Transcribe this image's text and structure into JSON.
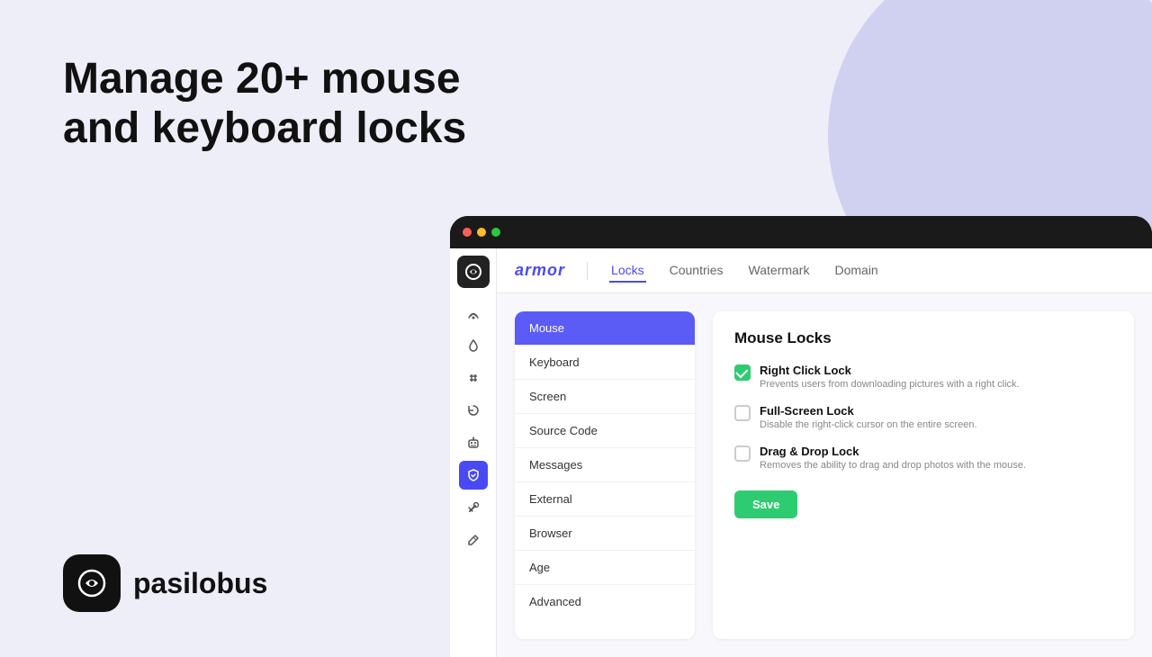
{
  "page": {
    "background_color": "#eeeef8"
  },
  "hero": {
    "line1": "Manage 20+ mouse",
    "line2": "and keyboard locks"
  },
  "brand": {
    "name": "pasilobus"
  },
  "app": {
    "nav": {
      "brand_name": "armor",
      "tabs": [
        {
          "id": "locks",
          "label": "Locks",
          "active": true
        },
        {
          "id": "countries",
          "label": "Countries",
          "active": false
        },
        {
          "id": "watermark",
          "label": "Watermark",
          "active": false
        },
        {
          "id": "domain",
          "label": "Domain",
          "active": false
        }
      ]
    },
    "categories": [
      {
        "id": "mouse",
        "label": "Mouse",
        "active": true
      },
      {
        "id": "keyboard",
        "label": "Keyboard",
        "active": false
      },
      {
        "id": "screen",
        "label": "Screen",
        "active": false
      },
      {
        "id": "source-code",
        "label": "Source Code",
        "active": false
      },
      {
        "id": "messages",
        "label": "Messages",
        "active": false
      },
      {
        "id": "external",
        "label": "External",
        "active": false
      },
      {
        "id": "browser",
        "label": "Browser",
        "active": false
      },
      {
        "id": "age",
        "label": "Age",
        "active": false
      },
      {
        "id": "advanced",
        "label": "Advanced",
        "active": false
      }
    ],
    "locks_panel": {
      "title": "Mouse Locks",
      "options": [
        {
          "id": "right-click",
          "name": "Right Click Lock",
          "description": "Prevents users from downloading pictures with a right click.",
          "checked": true
        },
        {
          "id": "full-screen",
          "name": "Full-Screen Lock",
          "description": "Disable the right-click cursor on the entire screen.",
          "checked": false
        },
        {
          "id": "drag-drop",
          "name": "Drag & Drop Lock",
          "description": "Removes the ability to drag and drop photos with the mouse.",
          "checked": false
        }
      ],
      "save_label": "Save"
    },
    "sidebar_icons": [
      {
        "id": "wifi",
        "symbol": "📡"
      },
      {
        "id": "drop",
        "symbol": "💧"
      },
      {
        "id": "hash",
        "symbol": "#"
      },
      {
        "id": "refresh",
        "symbol": "⟳"
      },
      {
        "id": "robot",
        "symbol": "🤖"
      },
      {
        "id": "shield",
        "symbol": "🛡"
      },
      {
        "id": "tools",
        "symbol": "🔧"
      },
      {
        "id": "pen",
        "symbol": "✏"
      }
    ]
  }
}
